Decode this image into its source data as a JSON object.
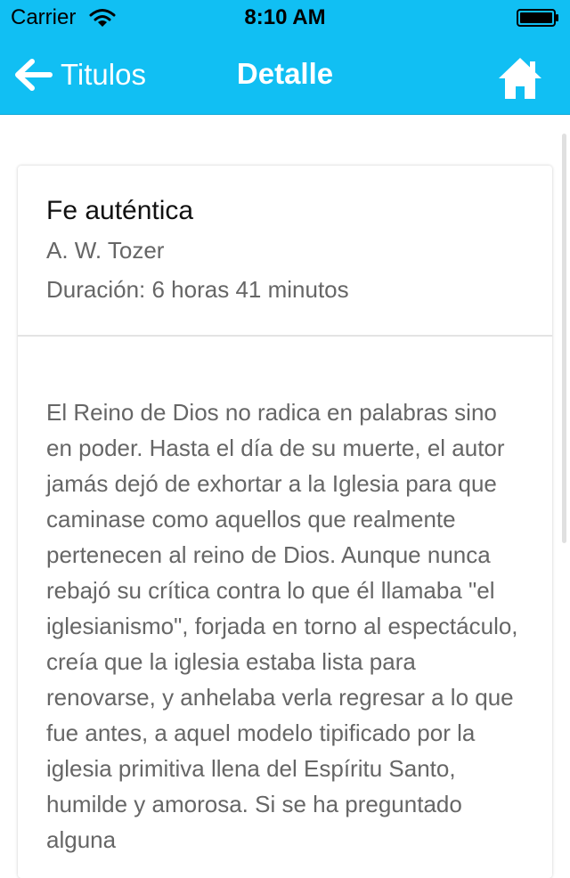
{
  "status_bar": {
    "carrier": "Carrier",
    "time": "8:10 AM",
    "wifi_icon": "wifi-icon",
    "battery_icon": "battery-icon"
  },
  "nav_bar": {
    "background": "#11BFF3",
    "back_label": "Titulos",
    "back_icon": "arrow-left-icon",
    "title": "Detalle",
    "home_icon": "home-icon"
  },
  "book": {
    "title": "Fe auténtica",
    "author": "A. W. Tozer",
    "duration": "Duración: 6 horas 41 minutos",
    "description": "El Reino de Dios no radica en palabras sino en poder. Hasta el día de su muerte, el autor jamás dejó de exhortar a la Iglesia para que caminase como aquellos que realmente pertenecen al reino de Dios. Aunque nunca rebajó su crítica contra lo que él llamaba \"el iglesianismo\", forjada en torno al espectáculo, creía que la iglesia estaba lista para renovarse, y anhelaba verla regresar a lo que fue antes, a aquel modelo tipificado por la iglesia primitiva llena del Espíritu Santo, humilde y amorosa. Si se ha preguntado alguna"
  }
}
